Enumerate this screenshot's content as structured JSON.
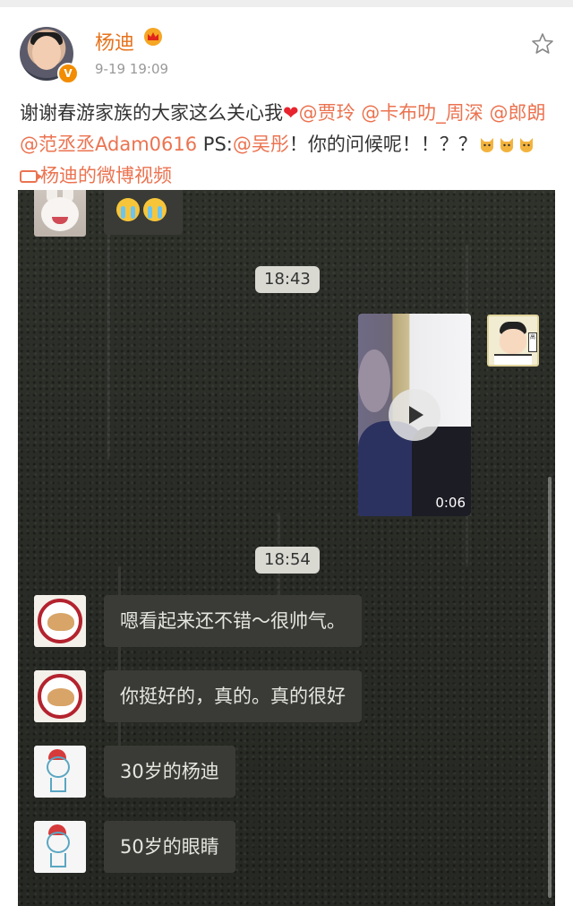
{
  "post": {
    "author": "杨迪",
    "timestamp": "9-19 19:09",
    "text": {
      "intro": "谢谢春游家族的大家这么关心我",
      "heart": "❤",
      "mentions": [
        "@贾玲",
        "@卡布叻_周深",
        "@郎朗",
        "@范丞丞Adam0616"
      ],
      "ps_prefix": "PS:",
      "ps_mention": "@吴彤",
      "ps_text": "！你的问候呢！！？？",
      "video_link": "杨迪的微博视频"
    },
    "icons": {
      "crown": "crown-icon",
      "verified": "verified-badge-icon",
      "favorite": "star-icon"
    },
    "accent_color": "#eb7350",
    "name_color": "#e6731d"
  },
  "chat": {
    "time_1": "18:43",
    "time_2": "18:54",
    "video_duration": "0:06",
    "messages": [
      {
        "sender": "cat-avatar",
        "text": "嗯看起来还不错～很帅气。"
      },
      {
        "sender": "cat-avatar",
        "text": "你挺好的，真的。真的很好"
      },
      {
        "sender": "boy-avatar",
        "text": "30岁的杨迪"
      },
      {
        "sender": "boy-avatar",
        "text": "50岁的眼睛"
      }
    ]
  }
}
